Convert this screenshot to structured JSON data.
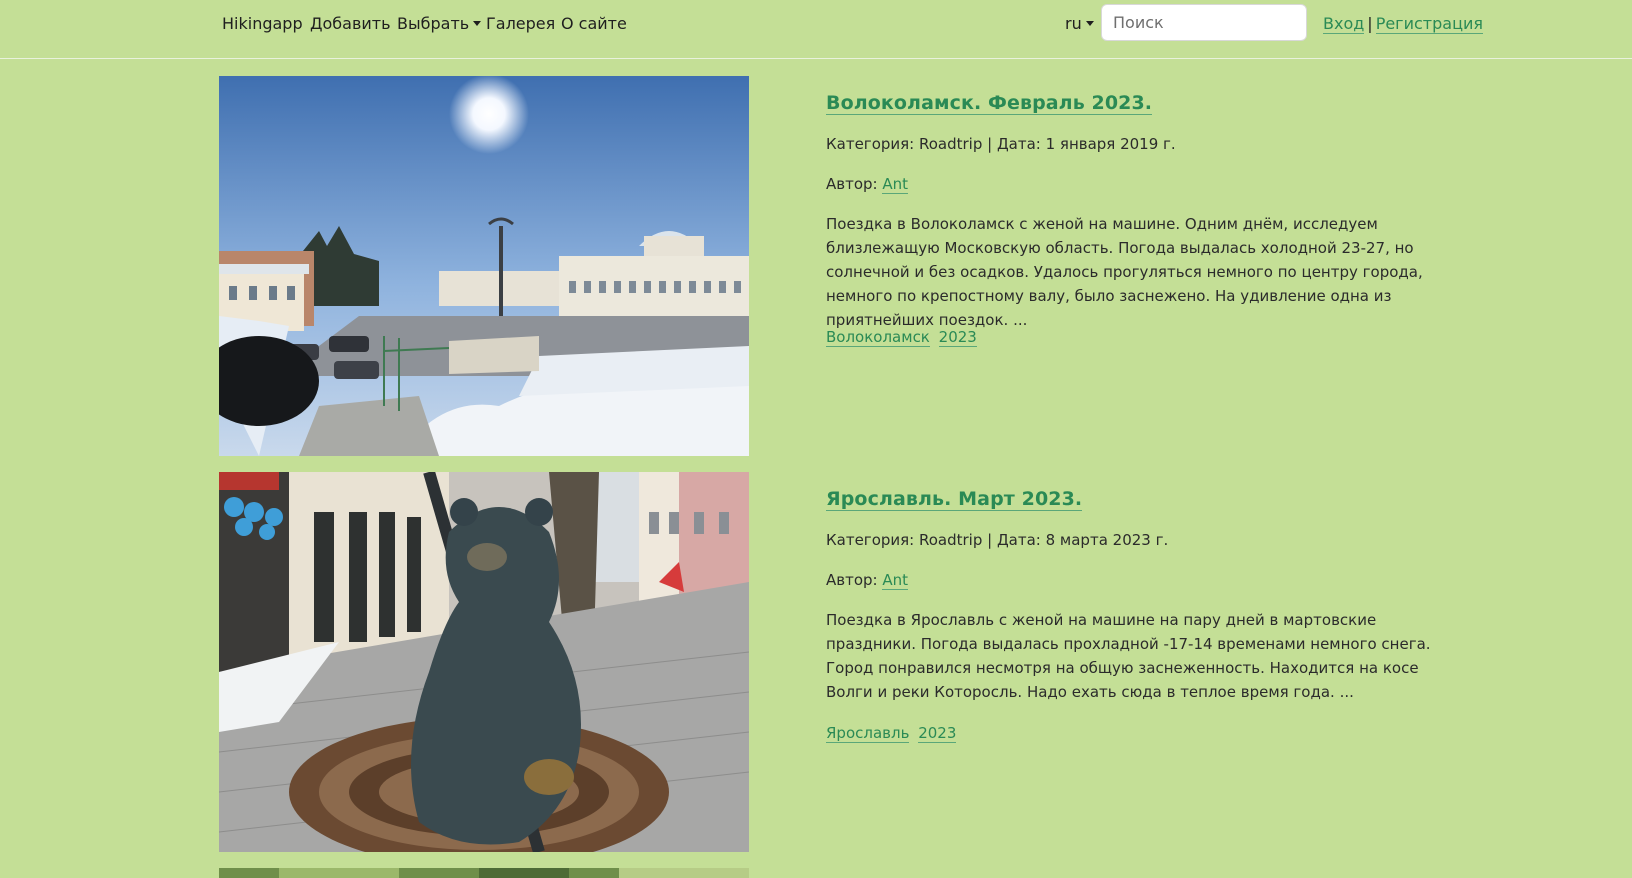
{
  "nav": {
    "brand": "Hikingapp",
    "add": "Добавить",
    "choose": "Выбрать",
    "gallery": "Галерея",
    "about": "О сайте",
    "lang": "ru",
    "search_placeholder": "Поиск",
    "login": "Вход",
    "separator": "|",
    "register": "Регистрация"
  },
  "posts": [
    {
      "title": "Волоколамск. Февраль 2023.",
      "meta": "Категория: Roadtrip | Дата: 1 января 2019 г.",
      "author_label": "Автор:",
      "author": "Ant",
      "excerpt": "Поездка в Волоколамск с женой на машине. Одним днём, исследуем близлежащую Московскую область. Погода выдалась холодной 23-27, но солнечной и без осадков. Удалось прогуляться немного по центру города, немного по крепостному валу, было заснежено. На удивление одна из приятнейших поездок. ...",
      "tags": [
        "Волоколамск",
        "2023"
      ],
      "photo": "snowy-town-square-photo"
    },
    {
      "title": "Ярославль. Март 2023.",
      "meta": "Категория: Roadtrip | Дата: 8 марта 2023 г.",
      "author_label": "Автор:",
      "author": "Ant",
      "excerpt": "Поездка в Ярославль с женой на машине на пару дней в мартовские праздники. Погода выдалась прохладной -17-14 временами немного снега. Город понравился несмотря на общую заснеженность. Находится на косе Волги и реки Которосль. Надо ехать сюда в теплое время года. ...",
      "tags": [
        "Ярославль",
        "2023"
      ],
      "photo": "bear-statue-photo"
    }
  ],
  "colors": {
    "background": "#c4df96",
    "link": "#2a8a55",
    "text": "#2b2b2b"
  }
}
